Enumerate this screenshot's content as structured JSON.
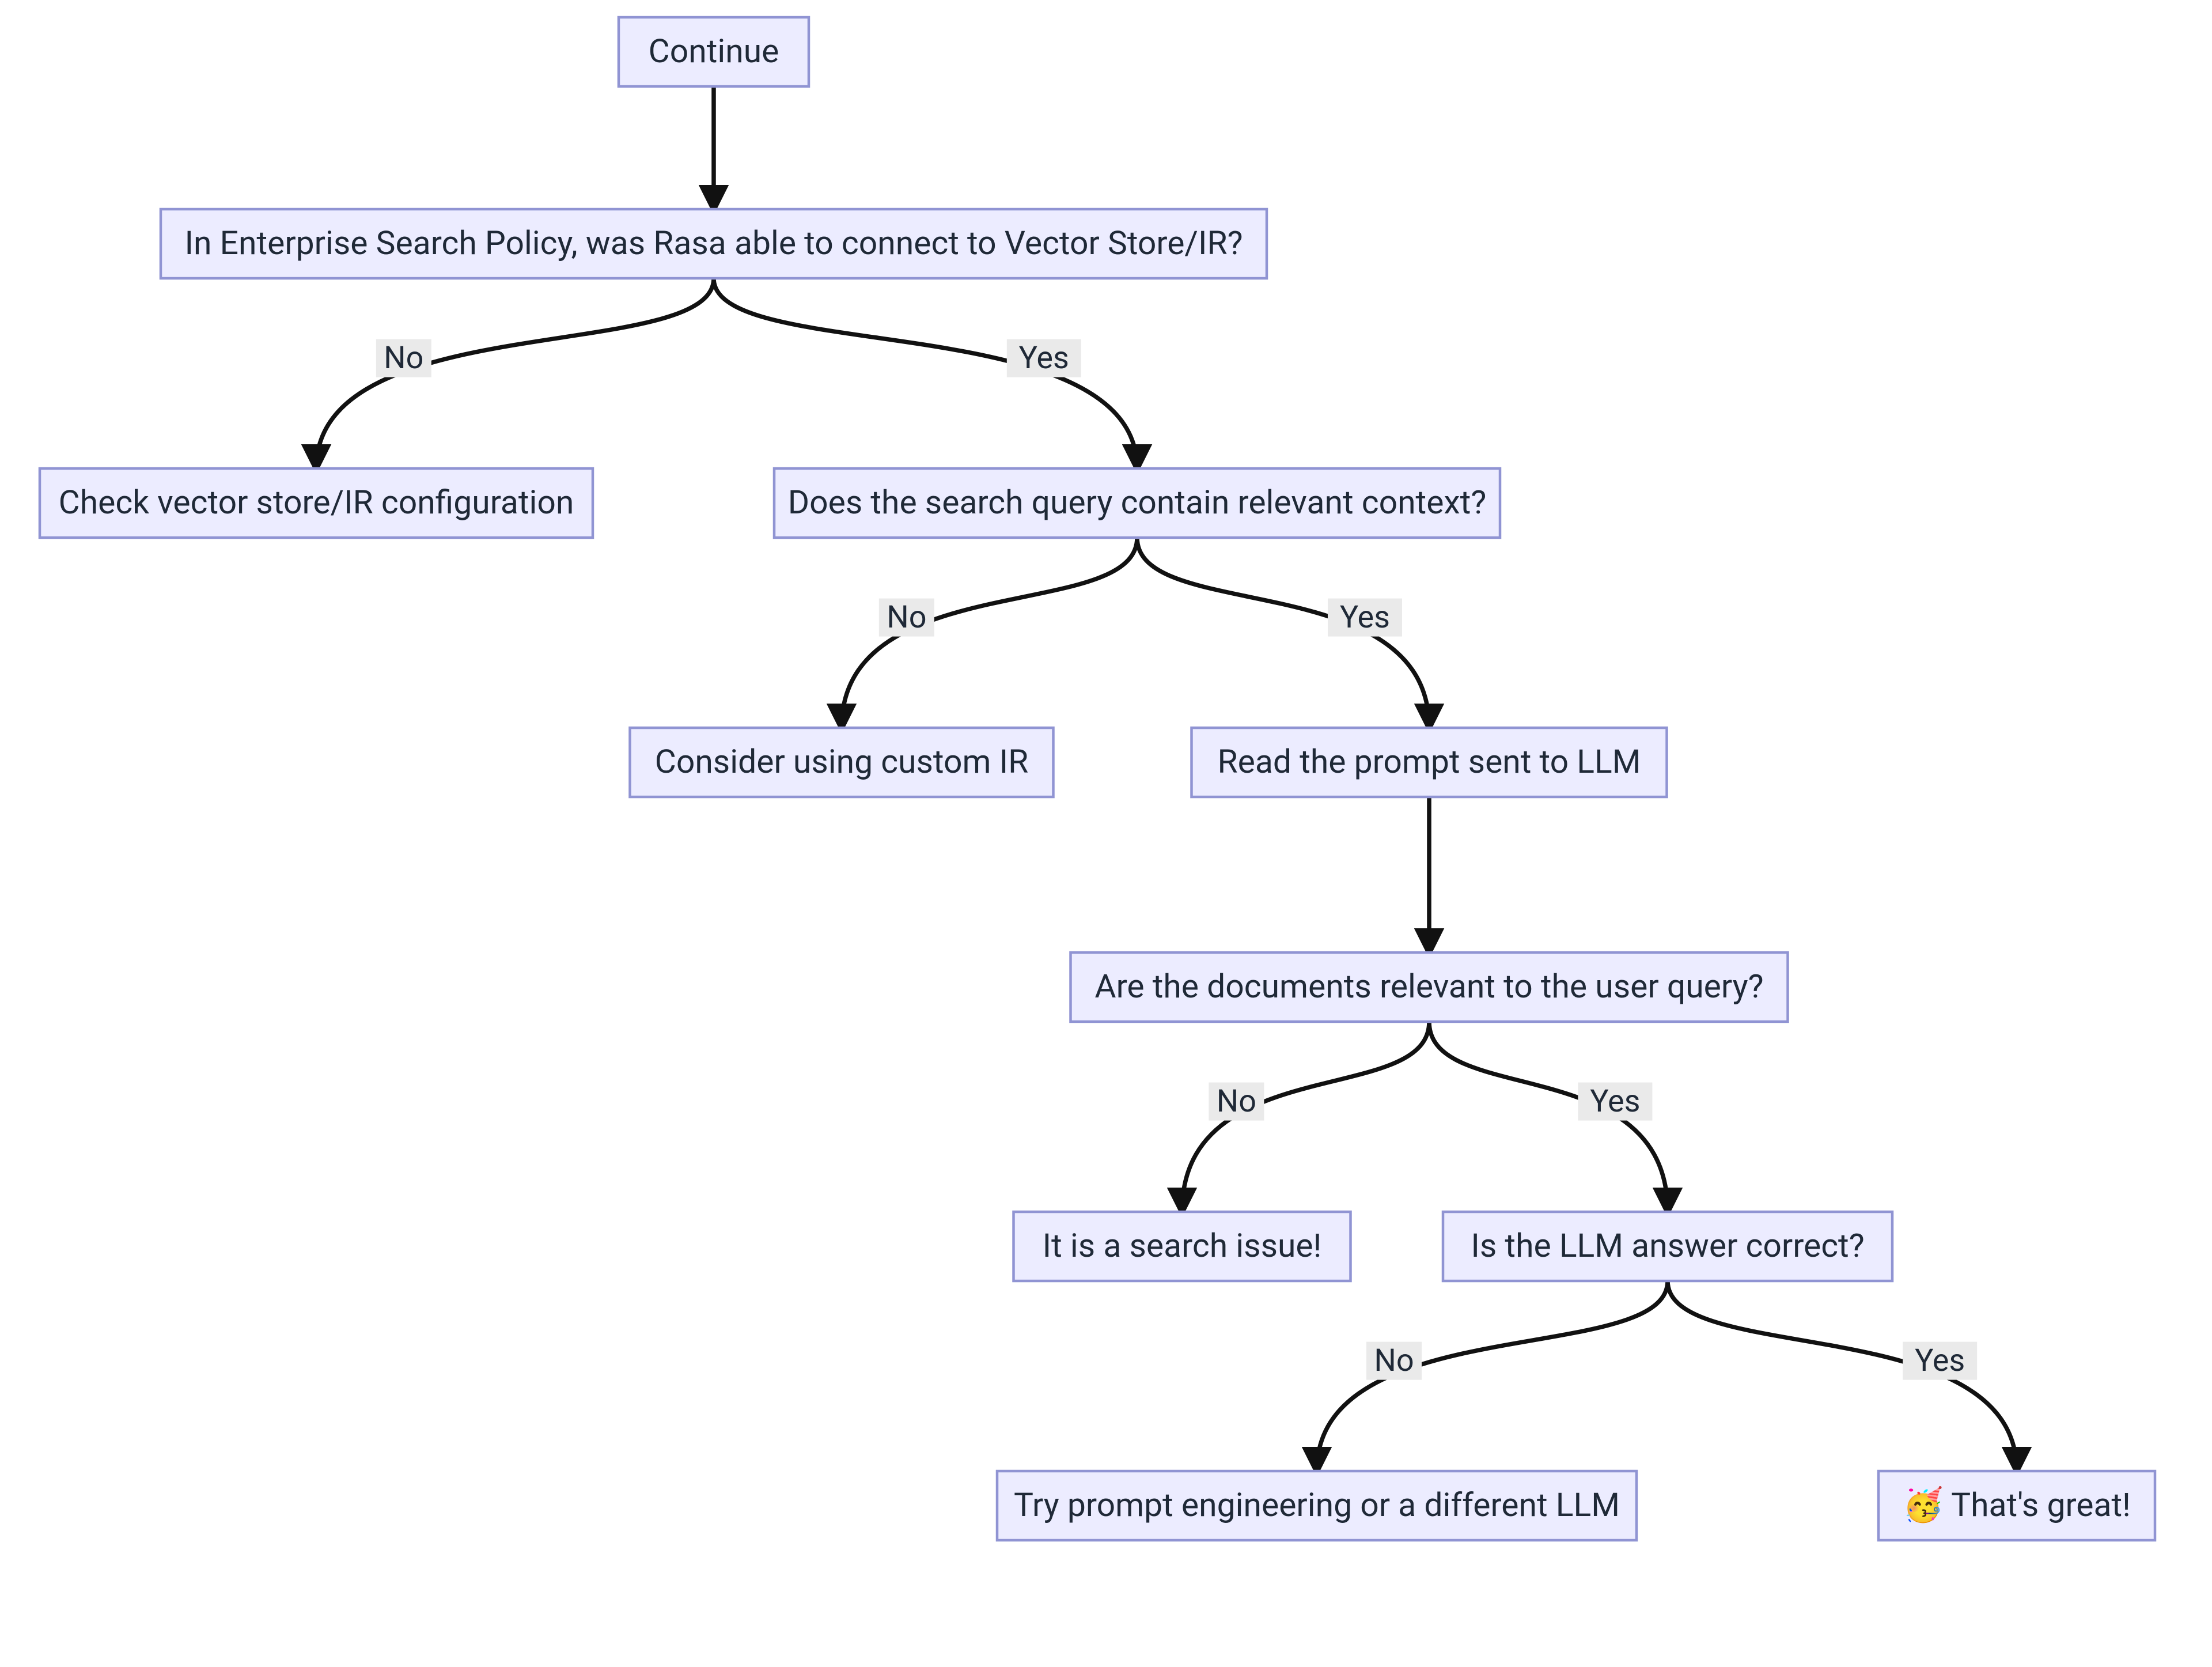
{
  "chart_data": {
    "type": "flowchart",
    "nodes": [
      {
        "id": "n0",
        "label": "Continue"
      },
      {
        "id": "n1",
        "label": "In Enterprise Search Policy, was Rasa able to connect to Vector Store/IR?"
      },
      {
        "id": "n2",
        "label": "Check vector store/IR configuration"
      },
      {
        "id": "n3",
        "label": "Does the search query contain relevant context?"
      },
      {
        "id": "n4",
        "label": "Consider using custom IR"
      },
      {
        "id": "n5",
        "label": "Read the prompt sent to LLM"
      },
      {
        "id": "n6",
        "label": "Are the documents relevant to the user query?"
      },
      {
        "id": "n7",
        "label": "It is a search issue!"
      },
      {
        "id": "n8",
        "label": "Is the LLM answer correct?"
      },
      {
        "id": "n9",
        "label": "Try prompt engineering or a different LLM"
      },
      {
        "id": "n10",
        "label": "🥳 That's great!"
      }
    ],
    "edges": [
      {
        "from": "n0",
        "to": "n1",
        "label": ""
      },
      {
        "from": "n1",
        "to": "n2",
        "label": "No"
      },
      {
        "from": "n1",
        "to": "n3",
        "label": "Yes"
      },
      {
        "from": "n3",
        "to": "n4",
        "label": "No"
      },
      {
        "from": "n3",
        "to": "n5",
        "label": "Yes"
      },
      {
        "from": "n5",
        "to": "n6",
        "label": ""
      },
      {
        "from": "n6",
        "to": "n7",
        "label": "No"
      },
      {
        "from": "n6",
        "to": "n8",
        "label": "Yes"
      },
      {
        "from": "n8",
        "to": "n9",
        "label": "No"
      },
      {
        "from": "n8",
        "to": "n10",
        "label": "Yes"
      }
    ]
  },
  "colors": {
    "node_fill": "#ececff",
    "node_stroke": "#9094d3",
    "edge_stroke": "#111111",
    "edge_label_bg": "#eaeaea",
    "text": "#1f2937"
  }
}
